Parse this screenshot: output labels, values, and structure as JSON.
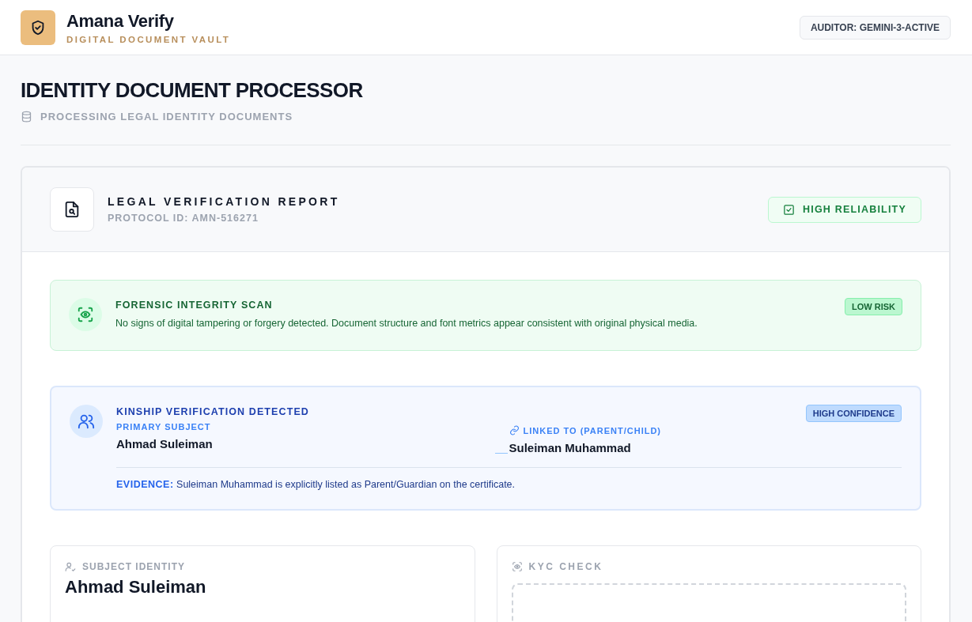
{
  "app": {
    "name": "Amana Verify",
    "tagline": "DIGITAL DOCUMENT VAULT",
    "auditor": "AUDITOR: GEMINI-3-ACTIVE"
  },
  "page": {
    "title": "IDENTITY DOCUMENT PROCESSOR",
    "subtitle": "PROCESSING LEGAL IDENTITY DOCUMENTS"
  },
  "report": {
    "title": "LEGAL VERIFICATION REPORT",
    "protocol": "PROTOCOL ID: AMN-516271",
    "reliability": "HIGH RELIABILITY"
  },
  "forensic": {
    "title": "FORENSIC INTEGRITY SCAN",
    "text": "No signs of digital tampering or forgery detected. Document structure and font metrics appear consistent with original physical media.",
    "badge": "LOW RISK"
  },
  "kinship": {
    "title": "KINSHIP VERIFICATION DETECTED",
    "badge": "HIGH CONFIDENCE",
    "primary_label": "PRIMARY SUBJECT",
    "primary_name": "Ahmad Suleiman",
    "linked_label": "LINKED TO (PARENT/CHILD)",
    "linked_name": "Suleiman Muhammad",
    "evidence_label": "EVIDENCE:",
    "evidence": "Suleiman Muhammad is explicitly listed as Parent/Guardian on the certificate."
  },
  "panels": [
    {
      "kind": "identity",
      "label": "SUBJECT IDENTITY",
      "name": "Ahmad Suleiman"
    },
    {
      "kind": "kyc",
      "label": "KYC CHECK"
    }
  ]
}
